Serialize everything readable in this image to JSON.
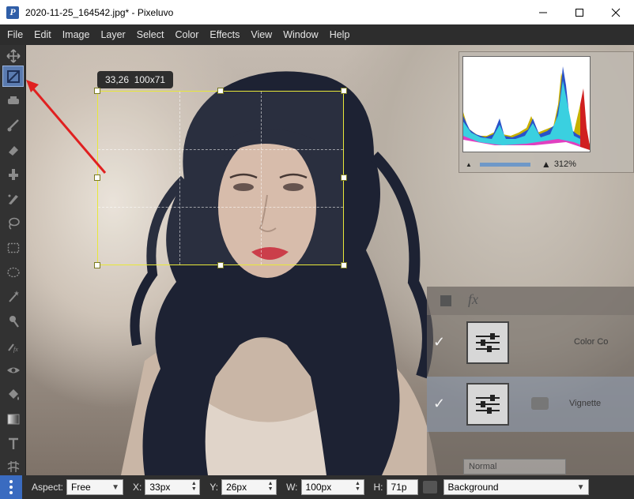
{
  "window": {
    "title": "2020-11-25_164542.jpg* - Pixeluvo",
    "app_icon_letter": "P",
    "controls": {
      "minimize": "minimize-icon",
      "maximize": "maximize-icon",
      "close": "close-icon"
    }
  },
  "menu": [
    "File",
    "Edit",
    "Image",
    "Layer",
    "Select",
    "Color",
    "Effects",
    "View",
    "Window",
    "Help"
  ],
  "toolbar": {
    "tools": [
      "move-icon",
      "crop-icon",
      "stamp-icon",
      "brush-icon",
      "eraser-icon",
      "clone-icon",
      "smudge-icon",
      "lasso-icon",
      "rect-select-icon",
      "ellipse-select-icon",
      "magic-wand-icon",
      "dodge-icon",
      "fx-brush-icon",
      "red-eye-icon",
      "fill-icon",
      "gradient-icon",
      "text-icon",
      "warp-icon"
    ],
    "active_tool": "crop-icon"
  },
  "selection": {
    "tooltip": "33,26  100x71"
  },
  "histogram": {
    "zoom": "312%"
  },
  "layers": {
    "row1_name": "Color Co",
    "row2_name": "Vignette",
    "blend_mode": "Normal"
  },
  "options": {
    "aspect_label": "Aspect:",
    "aspect_value": "Free",
    "x_label": "X:",
    "x_value": "33px",
    "y_label": "Y:",
    "y_value": "26px",
    "w_label": "W:",
    "w_value": "100px",
    "h_label": "H:",
    "h_value": "71p",
    "layer_value": "Background"
  },
  "colors": {
    "accent": "#3a6bc0",
    "selection": "#e8e83a",
    "annotation_arrow": "#e02020"
  }
}
